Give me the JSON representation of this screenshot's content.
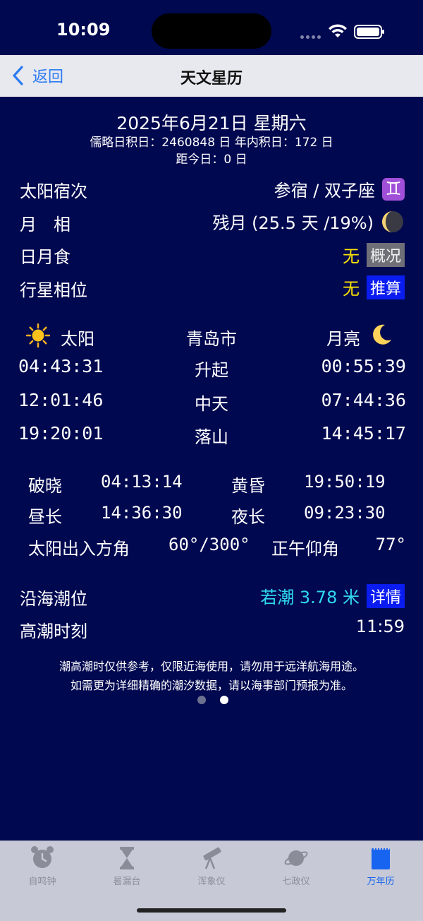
{
  "status": {
    "time": "10:09"
  },
  "nav": {
    "back_label": "返回",
    "title": "天文星历"
  },
  "header": {
    "date": "2025年6月21日 星期六",
    "julian": "儒略日积日：2460848 日  年内积日：172 日",
    "days_from_today": "距今日：0 日"
  },
  "info": {
    "sun_position": {
      "label": "太阳宿次",
      "value": "参宿 / 双子座",
      "icon": "gemini-icon"
    },
    "moon_phase": {
      "label": "月　相",
      "value": "残月 (25.5 天 /19%)",
      "icon": "waning-crescent-moon-icon"
    },
    "eclipse": {
      "label": "日月食",
      "value": "无",
      "button": "概况"
    },
    "planet_aspect": {
      "label": "行星相位",
      "value": "无",
      "button": "推算"
    }
  },
  "sunmoon": {
    "sun_label": "太阳",
    "city": "青岛市",
    "moon_label": "月亮",
    "rows": [
      {
        "sun": "04:43:31",
        "event": "升起",
        "moon": "00:55:39"
      },
      {
        "sun": "12:01:46",
        "event": "中天",
        "moon": "07:44:36"
      },
      {
        "sun": "19:20:01",
        "event": "落山",
        "moon": "14:45:17"
      }
    ]
  },
  "twilight": {
    "dawn_label": "破晓",
    "dawn": "04:13:14",
    "dusk_label": "黄昏",
    "dusk": "19:50:19",
    "day_label": "昼长",
    "day": "14:36:30",
    "night_label": "夜长",
    "night": "09:23:30",
    "azimuth_label": "太阳出入方角",
    "azimuth": "60°/300°",
    "noon_alt_label": "正午仰角",
    "noon_alt": "77°"
  },
  "tide": {
    "level_label": "沿海潮位",
    "level_value": "若潮 3.78 米",
    "detail_button": "详情",
    "high_label": "高潮时刻",
    "high_value": "11:59",
    "note1": "潮高潮时仅供参考，仅限近海使用，请勿用于远洋航海用途。",
    "note2": "如需更为详细精确的潮汐数据，请以海事部门预报为准。"
  },
  "pager": {
    "pages": 2,
    "current": 2
  },
  "tabs": [
    {
      "label": "自鸣钟",
      "icon": "alarm-clock-icon",
      "active": false
    },
    {
      "label": "晷漏台",
      "icon": "hourglass-icon",
      "active": false
    },
    {
      "label": "浑象仪",
      "icon": "telescope-icon",
      "active": false
    },
    {
      "label": "七政仪",
      "icon": "planet-icon",
      "active": false
    },
    {
      "label": "万年历",
      "icon": "calendar-icon",
      "active": true
    }
  ],
  "colors": {
    "background": "#000850",
    "highlight_yellow": "#ffe600",
    "tide_cyan": "#30d8f0",
    "button_blue": "#0a1cf0",
    "button_gray": "#6f6f78",
    "tab_active": "#1764f0"
  }
}
